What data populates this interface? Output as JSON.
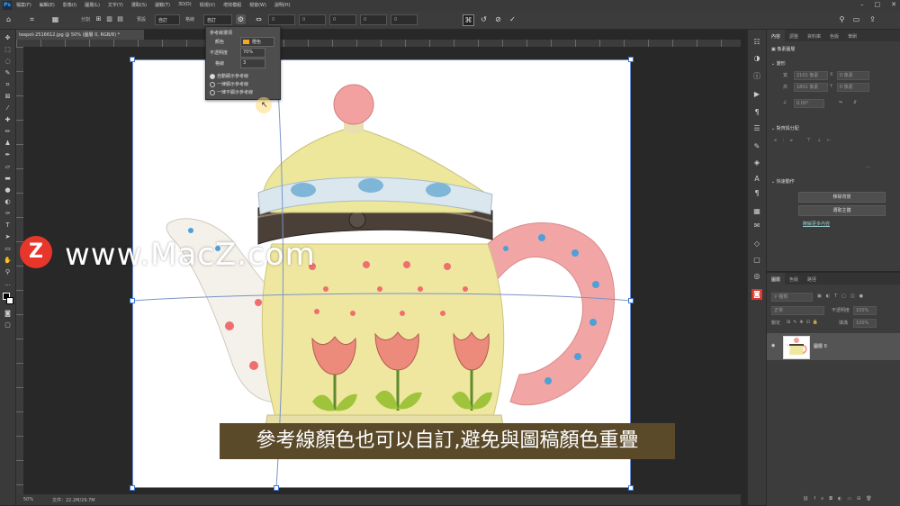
{
  "menubar": {
    "app_logo": "Ps",
    "items": [
      "檔案(F)",
      "編輯(E)",
      "影像(I)",
      "圖層(L)",
      "文字(Y)",
      "選取(S)",
      "濾鏡(T)",
      "3D(D)",
      "檢視(V)",
      "增效模組",
      "視窗(W)",
      "說明(H)"
    ],
    "window_controls": [
      "–",
      "□",
      "✕"
    ]
  },
  "options": {
    "split_label": "分割",
    "preset_label": "預設",
    "preset_value": "自訂",
    "grid_label": "格線",
    "grid_value": "自訂",
    "field_h": "0",
    "field_v": "0",
    "field_x": "0",
    "field_y": "0",
    "field_z": "0"
  },
  "document": {
    "tab_title": "teapot-2516612.jpg @ 50% (圖層 0, RGB/8) *",
    "status_zoom": "50%",
    "status_doc": "文件：22.2M/29.7M"
  },
  "guide_popup": {
    "title": "參考線選項",
    "color_label": "顏色",
    "color_value": "橙色",
    "opacity_label": "不透明度",
    "opacity_value": "70%",
    "count_label": "格線",
    "count_value": "3",
    "options": [
      "自動顯示參考線",
      "一律顯示參考線",
      "一律不顯示參考線"
    ],
    "selected": 0
  },
  "props": {
    "tabs": [
      "內容",
      "調整",
      "資料庫",
      "色版",
      "筆刷"
    ],
    "layer_type": "像素圖層",
    "transform_title": "變形",
    "w_label": "寬",
    "w_value": "2101 像素",
    "h_label": "高",
    "h_value": "1801 像素",
    "x_label": "X",
    "x_value": "0 像素",
    "y_label": "Y",
    "y_value": "0 像素",
    "angle_value": "0.00°",
    "align_title": "對齊與分配",
    "quick_title": "快速動作",
    "btn_remove_bg": "移除背景",
    "btn_select_subject": "選取主體",
    "learn_more": "瞭解更多內容"
  },
  "layers": {
    "tabs": [
      "圖層",
      "色版",
      "路徑"
    ],
    "filter_label": "種類",
    "blend_mode": "正常",
    "opacity_label": "不透明度",
    "opacity_value": "100%",
    "lock_label": "鎖定",
    "fill_label": "填滿",
    "fill_value": "100%",
    "layer_name": "圖層 0"
  },
  "watermark": {
    "logo": "Z",
    "text": "www.MacZ.com"
  },
  "subtitle": "參考線顏色也可以自訂,避免與圖稿顏色重疊",
  "colors": {
    "accent_orange": "#e8362a",
    "guide_color": "#f5a623",
    "subtitle_bg": "#5a4a2a"
  }
}
